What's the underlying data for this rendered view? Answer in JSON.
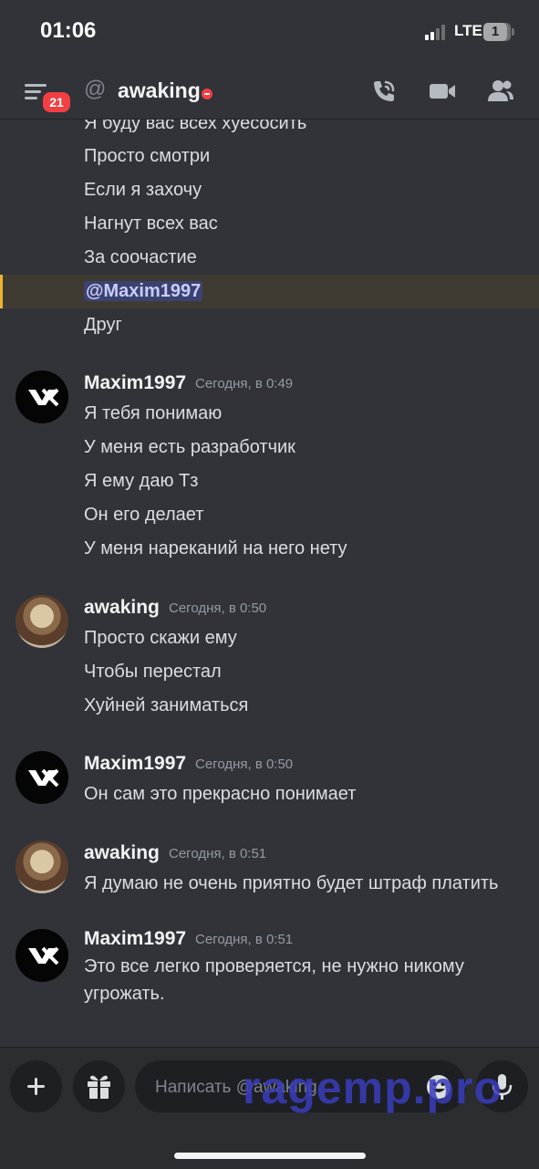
{
  "status_bar": {
    "time": "01:06",
    "network": "LTE",
    "battery": "1"
  },
  "header": {
    "menu_badge": "21",
    "at_symbol": "@",
    "dm_name": "awaking"
  },
  "messages": {
    "continued": {
      "lines": [
        "Я буду вас всех хуесосить",
        "Просто смотри",
        "Если я захочу",
        "Нагнут всех вас",
        "За соочастие"
      ],
      "mention": "@Maxim1997",
      "last_line": "Друг"
    },
    "groups": [
      {
        "author": "Maxim1997",
        "timestamp": "Сегодня, в 0:49",
        "avatar": "vk-logo-avatar",
        "lines": [
          "Я тебя понимаю",
          "У меня есть разработчик",
          "Я ему даю Тз",
          "Он его делает",
          "У меня нареканий на него нету"
        ]
      },
      {
        "author": "awaking",
        "timestamp": "Сегодня, в 0:50",
        "avatar": "photo-avatar",
        "lines": [
          "Просто скажи ему",
          "Чтобы перестал",
          "Хуйней заниматься"
        ]
      },
      {
        "author": "Maxim1997",
        "timestamp": "Сегодня, в 0:50",
        "avatar": "vk-logo-avatar",
        "lines": [
          "Он сам это прекрасно понимает"
        ]
      },
      {
        "author": "awaking",
        "timestamp": "Сегодня, в 0:51",
        "avatar": "photo-avatar",
        "lines": [
          "Я думаю не очень приятно будет штраф платить"
        ]
      },
      {
        "author": "Maxim1997",
        "timestamp": "Сегодня, в 0:51",
        "avatar": "vk-logo-avatar",
        "lines": [
          "Это все легко проверяется, не нужно никому",
          "угрожать."
        ]
      }
    ]
  },
  "composer": {
    "placeholder": "Написать @awaking"
  },
  "watermark": "ragemp.pro",
  "colors": {
    "background": "#313338",
    "mention_bg": "#3c4270",
    "highlight_bar": "#f0b232",
    "dnd_red": "#f23f43"
  },
  "icons": [
    "menu-icon",
    "phone-call-icon",
    "video-camera-icon",
    "members-icon",
    "plus-icon",
    "gift-icon",
    "emoji-icon",
    "microphone-icon"
  ]
}
